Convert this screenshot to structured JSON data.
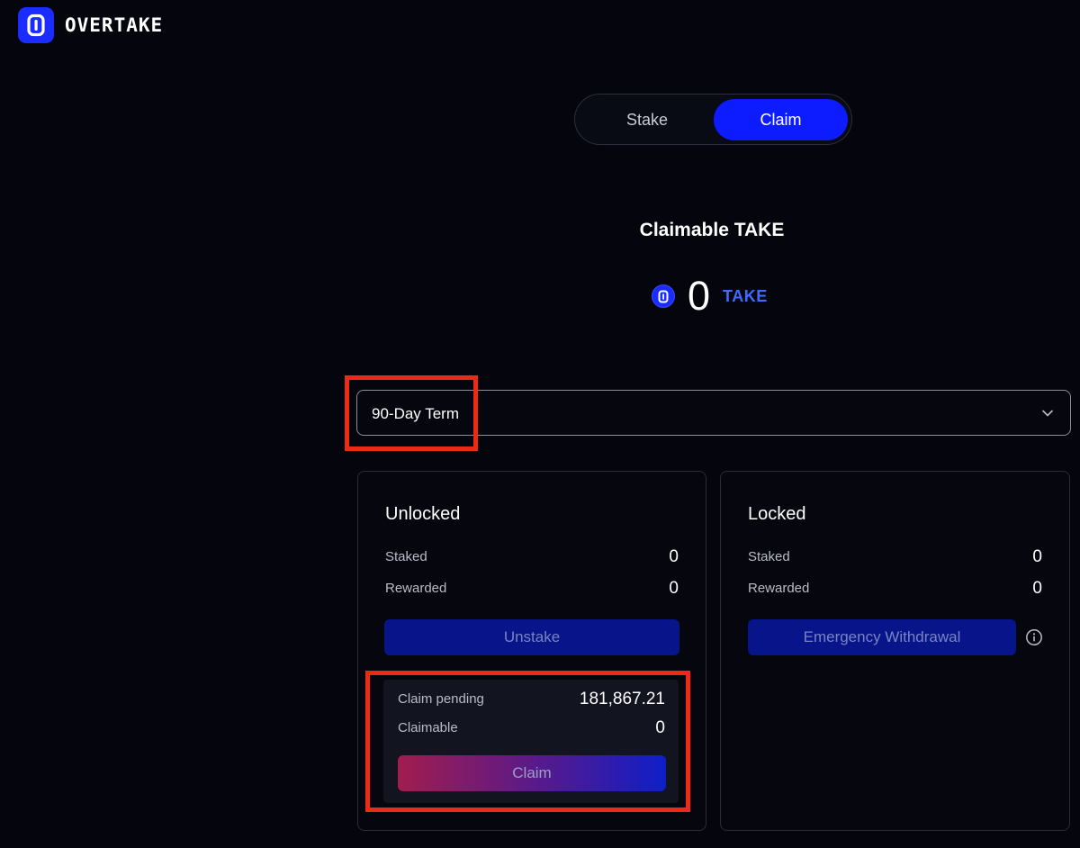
{
  "brand": {
    "name": "OVERTAKE",
    "logo_icon": "overtake-logo-icon",
    "color": "#1a2cff"
  },
  "toggle": {
    "stake_label": "Stake",
    "claim_label": "Claim",
    "active": "Claim",
    "accent": "#0c1cff"
  },
  "claimable": {
    "title": "Claimable TAKE",
    "amount": "0",
    "unit": "TAKE",
    "token_icon": "take-token-icon"
  },
  "term_select": {
    "selected": "90-Day Term",
    "icon": "chevron-down-icon"
  },
  "unlocked": {
    "title": "Unlocked",
    "staked_label": "Staked",
    "staked_value": "0",
    "rewarded_label": "Rewarded",
    "rewarded_value": "0",
    "action_label": "Unstake",
    "pending": {
      "claim_pending_label": "Claim pending",
      "claim_pending_value": "181,867.21",
      "claimable_label": "Claimable",
      "claimable_value": "0",
      "claim_label": "Claim"
    }
  },
  "locked": {
    "title": "Locked",
    "staked_label": "Staked",
    "staked_value": "0",
    "rewarded_label": "Rewarded",
    "rewarded_value": "0",
    "action_label": "Emergency Withdrawal",
    "info_icon": "info-icon"
  },
  "highlight_color": "#ee2a14"
}
